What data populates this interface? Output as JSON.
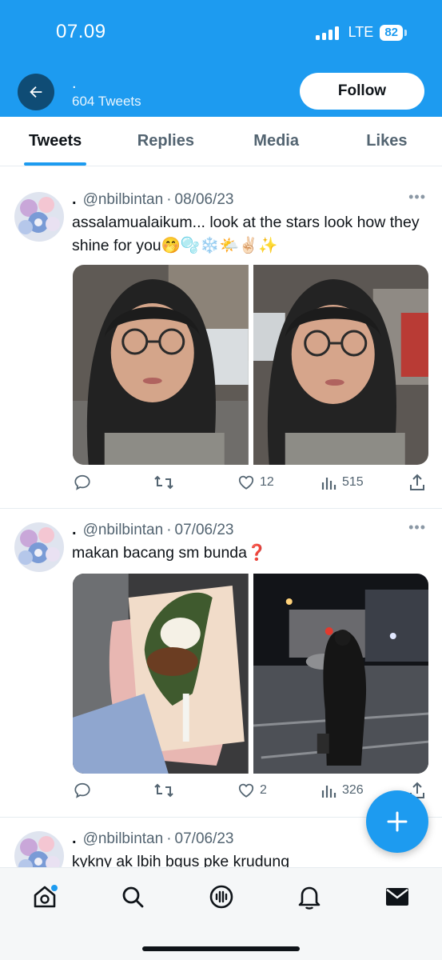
{
  "status_bar": {
    "time": "07.09",
    "network": "LTE",
    "battery": "82"
  },
  "header": {
    "profile_name": ".",
    "tweet_count": "604 Tweets",
    "follow_label": "Follow"
  },
  "tabs": [
    {
      "label": "Tweets",
      "active": true
    },
    {
      "label": "Replies",
      "active": false
    },
    {
      "label": "Media",
      "active": false
    },
    {
      "label": "Likes",
      "active": false
    }
  ],
  "tweets": [
    {
      "name": ".",
      "handle": "@nbilbintan",
      "date": "08/06/23",
      "text": "assalamualaikum... look at the stars look how they shine for you🤭🫧❄️🌤️✌🏻✨",
      "media": [
        "selfie-photo-car-front",
        "selfie-photo-car-side"
      ],
      "replies": "",
      "retweets": "",
      "likes": "12",
      "views": "515"
    },
    {
      "name": ".",
      "handle": "@nbilbintan",
      "date": "07/06/23",
      "text": "makan bacang sm bunda❓",
      "media": [
        "bacang-food-photo",
        "night-street-photo"
      ],
      "replies": "",
      "retweets": "",
      "likes": "2",
      "views": "326"
    },
    {
      "name": ".",
      "handle": "@nbilbintan",
      "date": "07/06/23",
      "text": "kykny ak lbih bgus pke krudung"
    }
  ],
  "icons": {
    "back": "arrow-left-icon",
    "more": "more-dots-icon",
    "reply": "reply-icon",
    "retweet": "retweet-icon",
    "like": "heart-icon",
    "views": "views-icon",
    "share": "share-icon",
    "compose": "plus-icon",
    "nav": [
      "home-icon",
      "search-icon",
      "spaces-icon",
      "notifications-icon",
      "messages-icon"
    ]
  },
  "colors": {
    "brand": "#1d9bf0",
    "text": "#0f1419",
    "muted": "#536471"
  }
}
